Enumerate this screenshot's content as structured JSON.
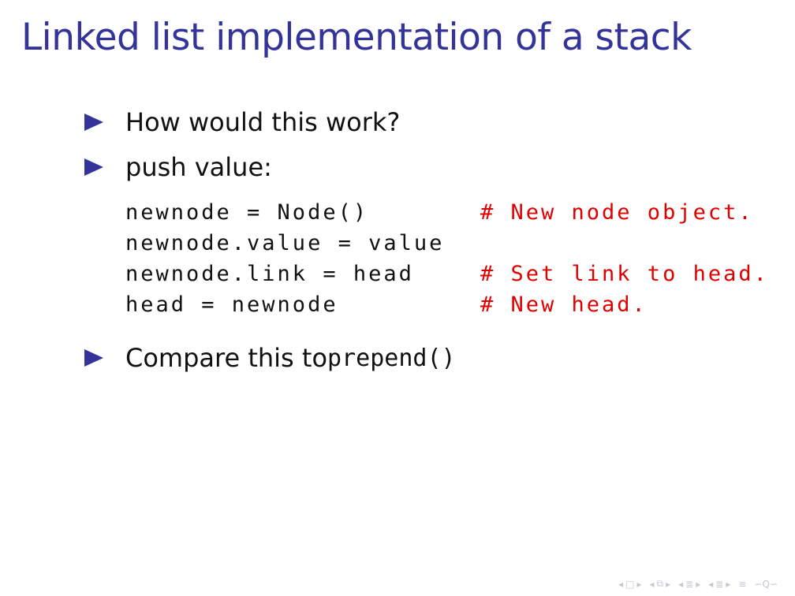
{
  "title": "Linked list implementation of a stack",
  "bullets": {
    "b1": "How would this work?",
    "b2": "push value:",
    "b3_text": "Compare this to ",
    "b3_code": "prepend()"
  },
  "code": [
    {
      "stmt": "newnode = Node()",
      "comment": "# New node object."
    },
    {
      "stmt": "newnode.value = value",
      "comment": ""
    },
    {
      "stmt": "newnode.link = head",
      "comment": "# Set link to head."
    },
    {
      "stmt": "head = newnode",
      "comment": "# New head."
    }
  ],
  "colors": {
    "title": "#33339a",
    "bullet": "#33339a",
    "comment": "#e00000",
    "nav": "#c6c6d6"
  },
  "nav_icons": [
    "nav-left-arrow-icon",
    "frame-icon",
    "nav-right-arrow-icon",
    "subsection-icon",
    "section-icon",
    "align-icon",
    "search-icon"
  ]
}
